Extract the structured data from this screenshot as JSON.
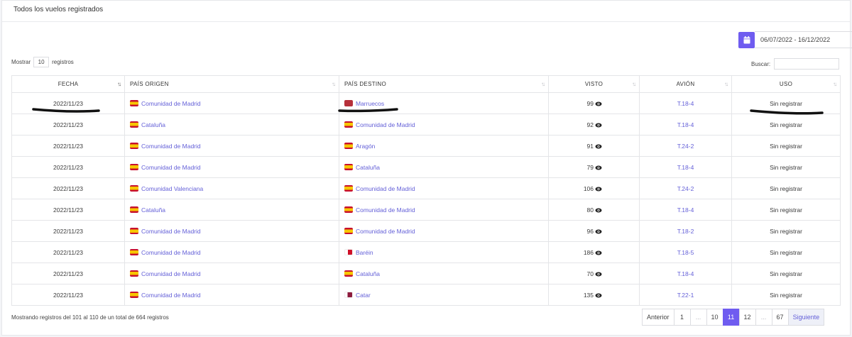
{
  "card": {
    "title": "Todos los vuelos registrados"
  },
  "date_range": {
    "value": "06/07/2022 - 16/12/2022"
  },
  "length": {
    "prefix": "Mostrar",
    "value": "10",
    "suffix": "registros"
  },
  "search": {
    "label": "Buscar:",
    "value": ""
  },
  "columns": [
    "FECHA",
    "PAÍS ORIGEN",
    "PAÍS DESTINO",
    "VISTO",
    "AVIÓN",
    "USO"
  ],
  "rows": [
    {
      "fecha": "2022/11/23",
      "origen": "Comunidad de Madrid",
      "origen_flag": "es",
      "destino": "Marruecos",
      "destino_flag": "ma",
      "visto": "99",
      "avion": "T.18-4",
      "uso": "Sin registrar"
    },
    {
      "fecha": "2022/11/23",
      "origen": "Cataluña",
      "origen_flag": "es",
      "destino": "Comunidad de Madrid",
      "destino_flag": "es",
      "visto": "92",
      "avion": "T.18-4",
      "uso": "Sin registrar"
    },
    {
      "fecha": "2022/11/23",
      "origen": "Comunidad de Madrid",
      "origen_flag": "es",
      "destino": "Aragón",
      "destino_flag": "es",
      "visto": "91",
      "avion": "T.24-2",
      "uso": "Sin registrar"
    },
    {
      "fecha": "2022/11/23",
      "origen": "Comunidad de Madrid",
      "origen_flag": "es",
      "destino": "Cataluña",
      "destino_flag": "es",
      "visto": "79",
      "avion": "T.18-4",
      "uso": "Sin registrar"
    },
    {
      "fecha": "2022/11/23",
      "origen": "Comunidad Valenciana",
      "origen_flag": "es",
      "destino": "Comunidad de Madrid",
      "destino_flag": "es",
      "visto": "106",
      "avion": "T.24-2",
      "uso": "Sin registrar"
    },
    {
      "fecha": "2022/11/23",
      "origen": "Cataluña",
      "origen_flag": "es",
      "destino": "Comunidad de Madrid",
      "destino_flag": "es",
      "visto": "80",
      "avion": "T.18-4",
      "uso": "Sin registrar"
    },
    {
      "fecha": "2022/11/23",
      "origen": "Comunidad de Madrid",
      "origen_flag": "es",
      "destino": "Comunidad de Madrid",
      "destino_flag": "es",
      "visto": "96",
      "avion": "T.18-2",
      "uso": "Sin registrar"
    },
    {
      "fecha": "2022/11/23",
      "origen": "Comunidad de Madrid",
      "origen_flag": "es",
      "destino": "Baréin",
      "destino_flag": "bh",
      "visto": "186",
      "avion": "T.18-5",
      "uso": "Sin registrar"
    },
    {
      "fecha": "2022/11/23",
      "origen": "Comunidad de Madrid",
      "origen_flag": "es",
      "destino": "Cataluña",
      "destino_flag": "es",
      "visto": "70",
      "avion": "T.18-4",
      "uso": "Sin registrar"
    },
    {
      "fecha": "2022/11/23",
      "origen": "Comunidad de Madrid",
      "origen_flag": "es",
      "destino": "Catar",
      "destino_flag": "qa",
      "visto": "135",
      "avion": "T.22-1",
      "uso": "Sin registrar"
    }
  ],
  "footer": {
    "info": "Mostrando registros del 101 al 110 de un total de 664 registros"
  },
  "pagination": {
    "prev": "Anterior",
    "pages": [
      "1",
      "...",
      "10",
      "11",
      "12",
      "...",
      "67"
    ],
    "active": "11",
    "next": "Siguiente"
  },
  "colors": {
    "accent": "#6f5cf0",
    "link": "#6460d8"
  },
  "icons": {
    "calendar": "calendar-icon",
    "visto": "eye-icon",
    "sort": "sort-arrows-icon"
  }
}
